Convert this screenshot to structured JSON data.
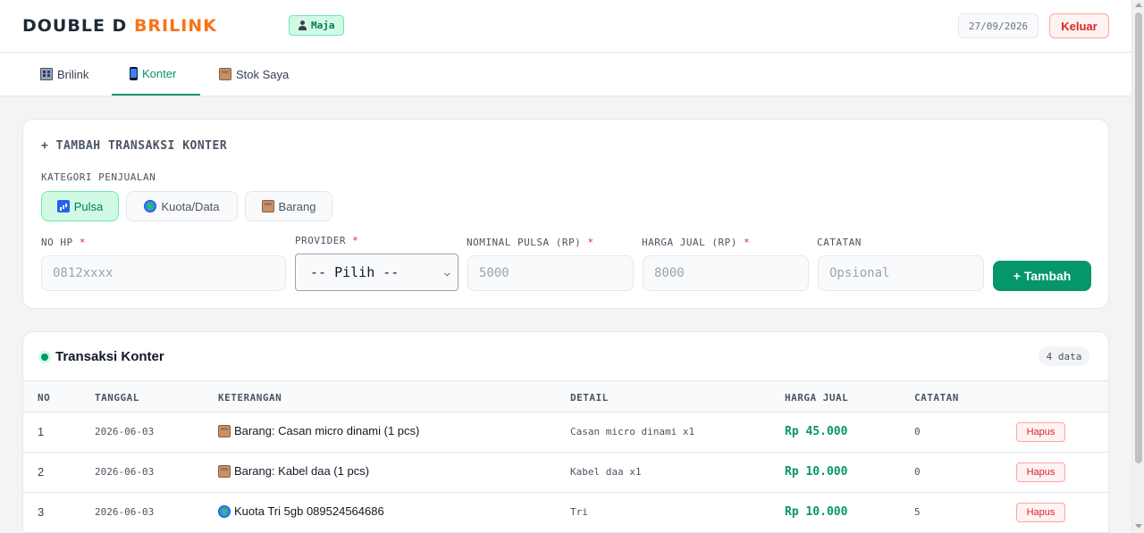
{
  "header": {
    "brand_part1": "DOUBLE D",
    "brand_part2": "BRILINK",
    "user_name": "Maja",
    "date": "27/09/2026",
    "logout_label": "Keluar",
    "brand_color_accent": "#f97316"
  },
  "tabs": [
    {
      "label": "Brilink",
      "icon": "building-icon",
      "active": false
    },
    {
      "label": "Konter",
      "icon": "phone-icon",
      "active": true
    },
    {
      "label": "Stok Saya",
      "icon": "box-icon",
      "active": false
    }
  ],
  "form": {
    "title": "+ TAMBAH TRANSAKSI KONTER",
    "category_label": "KATEGORI PENJUALAN",
    "categories": [
      {
        "label": "Pulsa",
        "icon": "signal-icon",
        "active": true
      },
      {
        "label": "Kuota/Data",
        "icon": "globe-icon",
        "active": false
      },
      {
        "label": "Barang",
        "icon": "box-icon",
        "active": false
      }
    ],
    "required_mark": "*",
    "fields": {
      "no_hp": {
        "label": "NO HP",
        "placeholder": "0812xxxx"
      },
      "provider": {
        "label": "PROVIDER",
        "value": "-- Pilih --"
      },
      "nominal": {
        "label": "NOMINAL PULSA (RP)",
        "placeholder": "5000"
      },
      "harga_jual": {
        "label": "HARGA JUAL (RP)",
        "placeholder": "8000"
      },
      "catatan": {
        "label": "CATATAN",
        "placeholder": "Opsional"
      }
    },
    "submit_label": "+ Tambah"
  },
  "table": {
    "title": "Transaksi Konter",
    "count_label": "4 data",
    "columns": [
      "NO",
      "TANGGAL",
      "KETERANGAN",
      "DETAIL",
      "HARGA JUAL",
      "CATATAN"
    ],
    "delete_label": "Hapus",
    "rows": [
      {
        "no": "1",
        "tanggal": "2026-06-03",
        "icon": "box-icon",
        "keterangan": "Barang: Casan micro dinami (1 pcs)",
        "detail": "Casan micro dinami x1",
        "harga": "Rp 45.000",
        "catatan": "0"
      },
      {
        "no": "2",
        "tanggal": "2026-06-03",
        "icon": "box-icon",
        "keterangan": "Barang: Kabel daa (1 pcs)",
        "detail": "Kabel daa x1",
        "harga": "Rp 10.000",
        "catatan": "0"
      },
      {
        "no": "3",
        "tanggal": "2026-06-03",
        "icon": "globe-icon",
        "keterangan": "Kuota Tri 5gb 089524564686",
        "detail": "Tri",
        "harga": "Rp 10.000",
        "catatan": "5"
      }
    ]
  },
  "colors": {
    "primary": "#059669",
    "danger": "#dc2626",
    "background": "#f3f4f6"
  }
}
